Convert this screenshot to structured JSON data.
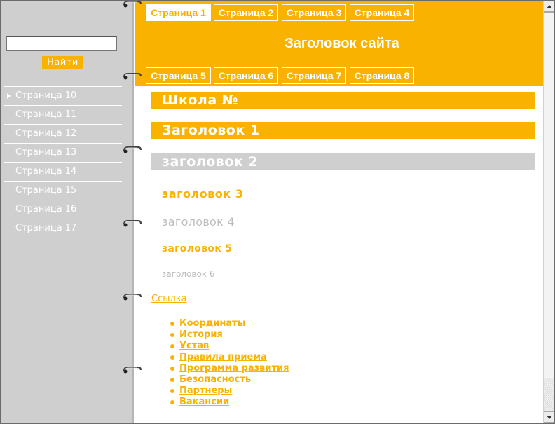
{
  "search": {
    "value": "",
    "placeholder": "",
    "button_label": "Найти"
  },
  "sidebar": {
    "items": [
      {
        "label": "Страница 10",
        "active": true
      },
      {
        "label": "Страница 11"
      },
      {
        "label": "Страница 12"
      },
      {
        "label": "Страница 13"
      },
      {
        "label": "Страница 14"
      },
      {
        "label": "Страница 15"
      },
      {
        "label": "Страница 16"
      },
      {
        "label": "Страница 17"
      }
    ]
  },
  "header": {
    "title": "Заголовок сайта",
    "tabs_top": [
      "Страница 1",
      "Страница 2",
      "Страница 3",
      "Страница 4"
    ],
    "tabs_bottom": [
      "Страница 5",
      "Страница 6",
      "Страница 7",
      "Страница 8"
    ],
    "active_tab": "Страница 1"
  },
  "content": {
    "school_title": "Школа №",
    "h1": "Заголовок 1",
    "h2": "заголовок 2",
    "h3": "заголовок 3",
    "h4": "заголовок 4",
    "h5": "заголовок 5",
    "h6": "заголовок 6",
    "link": "Ссылка",
    "bullets": [
      "Координаты",
      "История",
      "Устав",
      "Правила приема",
      "Программа развития",
      "Безопасность",
      "Партнеры",
      "Вакансии"
    ]
  },
  "colors": {
    "accent": "#f9b200",
    "sidebar_bg": "#cfcfcf",
    "gray_heading": "#bdbdbd"
  },
  "icons": {
    "binder_ring": "binder-ring-icon",
    "arrow": "triangle-right-icon"
  }
}
